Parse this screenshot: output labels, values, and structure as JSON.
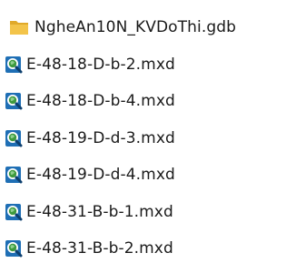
{
  "files": [
    {
      "name": "NgheAn10N_KVDoThi.gdb",
      "icon": "folder-icon",
      "type": "geodatabase"
    },
    {
      "name": "E-48-18-D-b-2.mxd",
      "icon": "arcmap-document-icon",
      "type": "mxd"
    },
    {
      "name": "E-48-18-D-b-4.mxd",
      "icon": "arcmap-document-icon",
      "type": "mxd"
    },
    {
      "name": "E-48-19-D-d-3.mxd",
      "icon": "arcmap-document-icon",
      "type": "mxd"
    },
    {
      "name": "E-48-19-D-d-4.mxd",
      "icon": "arcmap-document-icon",
      "type": "mxd"
    },
    {
      "name": "E-48-31-B-b-1.mxd",
      "icon": "arcmap-document-icon",
      "type": "mxd"
    },
    {
      "name": "E-48-31-B-b-2.mxd",
      "icon": "arcmap-document-icon",
      "type": "mxd"
    }
  ],
  "colors": {
    "folder": "#f3c44a",
    "folder_dark": "#e0a92a",
    "mxd_blue": "#1f6fb5",
    "mxd_green": "#3d9a3d",
    "text": "#1a1a1a"
  }
}
